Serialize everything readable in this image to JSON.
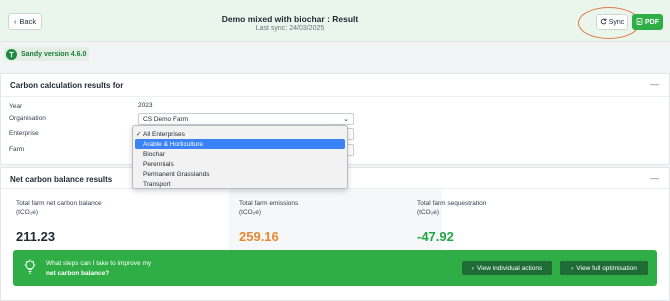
{
  "header": {
    "back_label": "Back",
    "title": "Demo mixed with biochar : Result",
    "subtitle": "Last sync: 24/03/2025",
    "sync_label": "Sync",
    "pdf_label": "PDF"
  },
  "version": "Sandy version 4.6.0",
  "calc": {
    "title": "Carbon calculation results for",
    "year_label": "Year",
    "year_value": "2023",
    "organisation_label": "Organisation",
    "organisation_value": "CS Demo Farm",
    "enterprise_label": "Enterprise",
    "farm_label": "Farm"
  },
  "dropdown": {
    "options": [
      "All Enterprises",
      "Arable & Horticulture",
      "Biochar",
      "Perennials",
      "Permanent Grasslands",
      "Transport"
    ],
    "selected": "All Enterprises",
    "highlighted": "Arable & Horticulture"
  },
  "net": {
    "title": "Net carbon balance results",
    "stats": [
      {
        "label1": "Total farm net carbon balance",
        "label2": "(tCO₂e)",
        "value": "211.23",
        "color": "#1f2933"
      },
      {
        "label1": "Total farm emissions",
        "label2": "(tCO₂e)",
        "value": "259.16",
        "color": "#e8872f"
      },
      {
        "label1": "Total farm sequestration",
        "label2": "(tCO₂e)",
        "value": "-47.92",
        "color": "#22a447"
      }
    ]
  },
  "banner": {
    "line1": "What steps can I take to improve my",
    "line2": "net carbon balance?",
    "btn_actions": "View individual actions",
    "btn_optimisation": "View full optimisation"
  },
  "colors": {
    "brand_green": "#2eae45",
    "highlight_blue": "#3b82f6",
    "annotation_orange": "#e07a4c"
  },
  "icons": [
    "chevron-left-icon",
    "sync-icon",
    "pdf-icon",
    "sandy-logo-icon",
    "minus-icon",
    "chevron-down-icon",
    "checkmark-icon",
    "lightbulb-icon",
    "chevron-right-icon"
  ]
}
